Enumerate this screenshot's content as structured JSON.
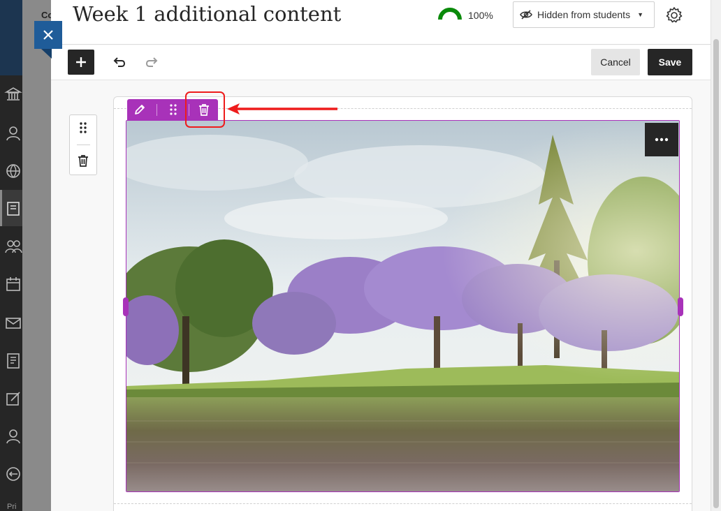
{
  "background": {
    "nav_bottom_text": "Pri",
    "partial_course_text": "Co",
    "nav_icons": [
      "institution-icon",
      "profile-icon",
      "globe-icon",
      "courses-icon",
      "groups-icon",
      "calendar-icon",
      "messages-icon",
      "grades-icon",
      "tools-icon",
      "people-icon",
      "signout-icon"
    ]
  },
  "header": {
    "title": "Week 1 additional content",
    "progress_percent": "100%",
    "progress_value": 1.0,
    "visibility_label": "Hidden from students",
    "colors": {
      "progress": "#0a8a0a",
      "accent": "#a832b9",
      "close": "#1f5c99"
    }
  },
  "toolbar": {
    "cancel_label": "Cancel",
    "save_label": "Save"
  },
  "image_block": {
    "alt": "Lake with jacaranda trees in bloom"
  },
  "annotation": {
    "color": "#ee1c1c"
  }
}
